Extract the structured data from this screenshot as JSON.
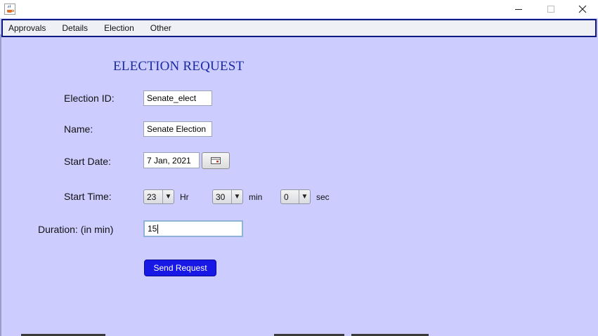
{
  "window": {
    "app_icon": "java-coffee-cup-icon",
    "controls": [
      "minimize-icon",
      "maximize-icon",
      "close-icon"
    ]
  },
  "menubar": {
    "items": [
      "Approvals",
      "Details",
      "Election",
      "Other"
    ]
  },
  "form": {
    "title": "ELECTION REQUEST",
    "election_id_label": "Election ID:",
    "election_id_value": "Senate_elect",
    "name_label": "Name:",
    "name_value": "Senate Election",
    "start_date_label": "Start Date:",
    "start_date_value": "7 Jan, 2021",
    "calendar_icon": "calendar-icon",
    "start_time_label": "Start Time:",
    "hour_value": "23",
    "hour_unit": "Hr",
    "minute_value": "30",
    "minute_unit": "min",
    "second_value": "0",
    "second_unit": "sec",
    "duration_label": "Duration: (in min)",
    "duration_value": "15",
    "submit_label": "Send Request"
  },
  "colors": {
    "background": "#ccccff",
    "title_text": "#1a2aa0",
    "menubar_border": "#0a1a80",
    "button": "#1818e6"
  }
}
